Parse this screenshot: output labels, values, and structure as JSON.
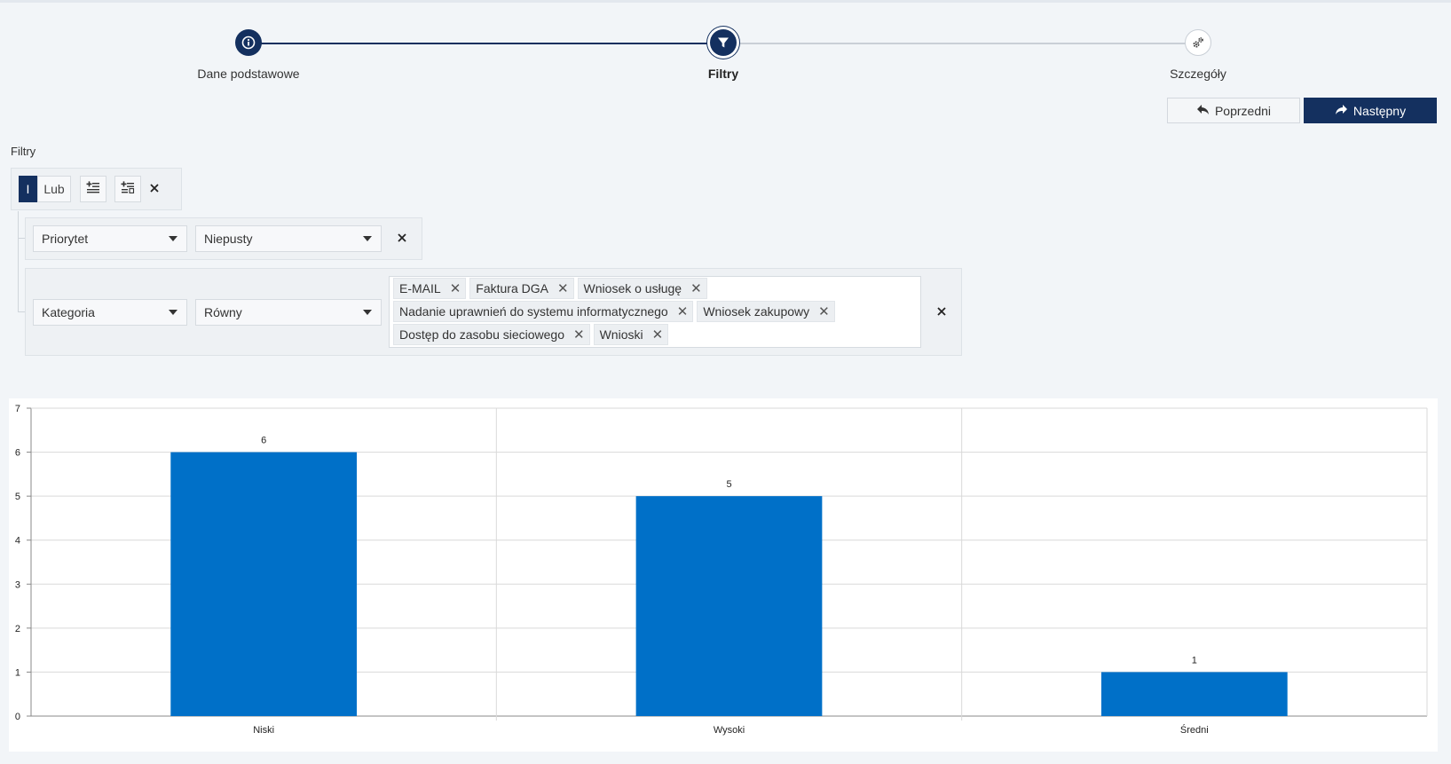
{
  "stepper": {
    "steps": [
      {
        "label": "Dane podstawowe",
        "icon": "info-icon",
        "state": "completed"
      },
      {
        "label": "Filtry",
        "icon": "filter-icon",
        "state": "active"
      },
      {
        "label": "Szczegóły",
        "icon": "gears-icon",
        "state": "pending"
      }
    ]
  },
  "nav": {
    "prev_label": "Poprzedni",
    "next_label": "Następny"
  },
  "filters": {
    "title": "Filtry",
    "group": {
      "and_label": "I",
      "or_label": "Lub",
      "selected": "I"
    },
    "rules": [
      {
        "field": "Priorytet",
        "operator": "Niepusty",
        "values": []
      },
      {
        "field": "Kategoria",
        "operator": "Równy",
        "values": [
          "E-MAIL",
          "Faktura DGA",
          "Wniosek o usługę",
          "Nadanie uprawnień do systemu informatycznego",
          "Wniosek zakupowy",
          "Dostęp do zasobu sieciowego",
          "Wnioski"
        ]
      }
    ]
  },
  "colors": {
    "primary": "#14305f",
    "bar": "#0070c8"
  },
  "chart_data": {
    "type": "bar",
    "categories": [
      "Niski",
      "Wysoki",
      "Średni"
    ],
    "values": [
      6,
      5,
      1
    ],
    "title": "",
    "xlabel": "",
    "ylabel": "",
    "ylim": [
      0,
      7
    ],
    "yticks": [
      0,
      1,
      2,
      3,
      4,
      5,
      6,
      7
    ],
    "data_labels": true,
    "grid": true
  }
}
